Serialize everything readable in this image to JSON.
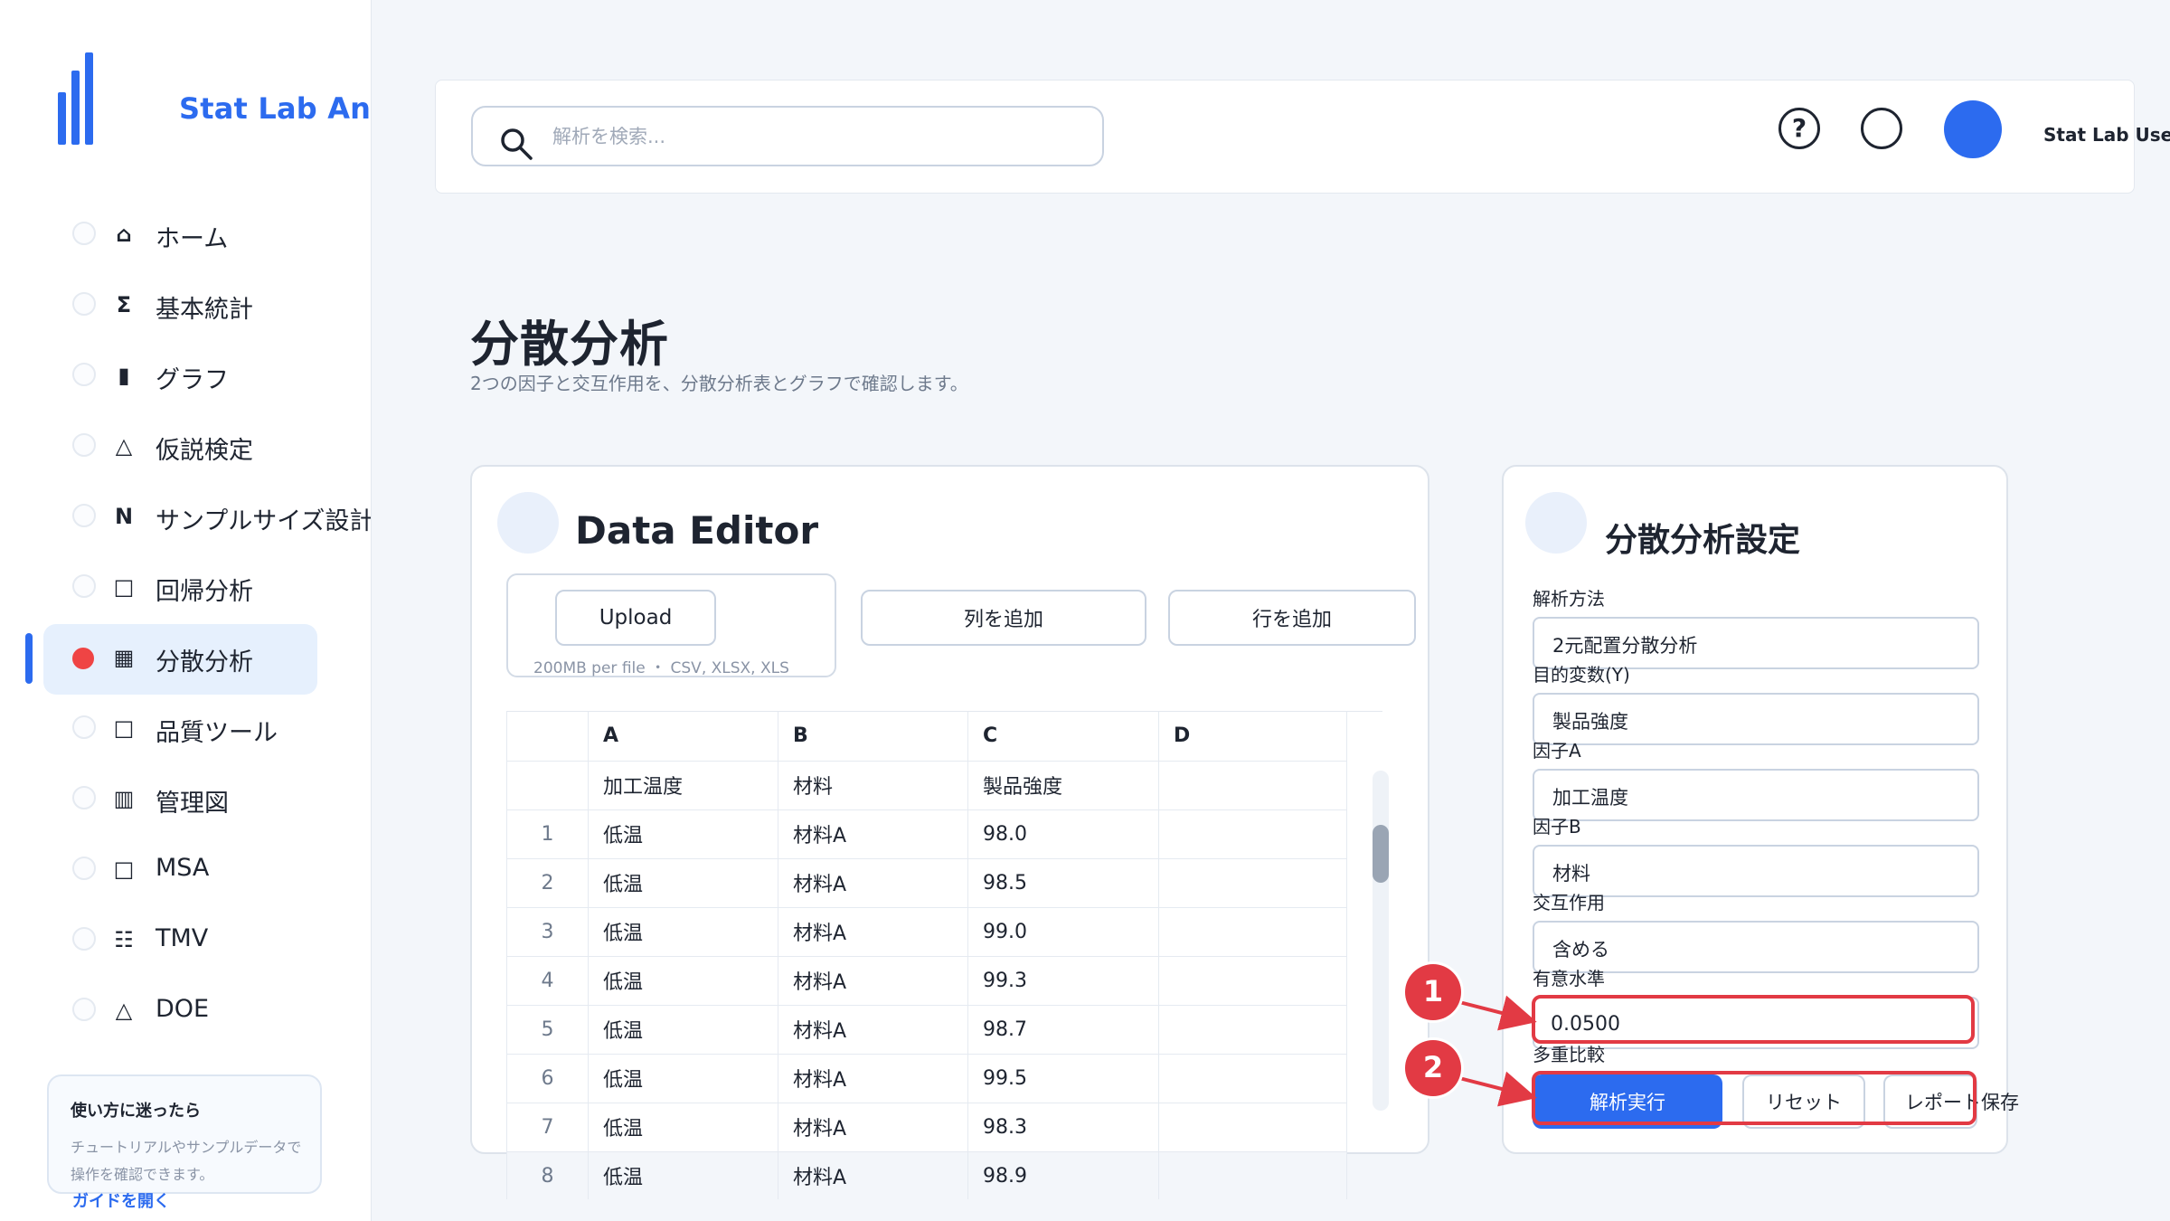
{
  "app": {
    "name": "Stat Lab Analytics"
  },
  "sidebar": {
    "items": [
      {
        "icon": "home-icon",
        "glyph": "⌂",
        "label": "ホーム"
      },
      {
        "icon": "sigma-icon",
        "glyph": "Σ",
        "label": "基本統計"
      },
      {
        "icon": "bar-chart-icon",
        "glyph": "▮",
        "label": "グラフ"
      },
      {
        "icon": "triangle-icon",
        "glyph": "△",
        "label": "仮説検定"
      },
      {
        "icon": "n-letter-icon",
        "glyph": "N",
        "label": "サンプルサイズ設計"
      },
      {
        "icon": "square-icon",
        "glyph": "□",
        "label": "回帰分析"
      },
      {
        "icon": "grid-icon",
        "glyph": "▦",
        "label": "分散分析",
        "active": true
      },
      {
        "icon": "square-icon",
        "glyph": "□",
        "label": "品質ツール"
      },
      {
        "icon": "bars-icon",
        "glyph": "▥",
        "label": "管理図"
      },
      {
        "icon": "square-icon",
        "glyph": "□",
        "label": "MSA"
      },
      {
        "icon": "list-icon",
        "glyph": "☷",
        "label": "TMV"
      },
      {
        "icon": "triangle-icon",
        "glyph": "△",
        "label": "DOE"
      }
    ],
    "help": {
      "title": "使い方に迷ったら",
      "body": "チュートリアルやサンプルデータで操作を確認できます。",
      "link": "ガイドを開く"
    }
  },
  "header": {
    "search_placeholder": "解析を検索...",
    "help_glyph": "?",
    "user_name": "Stat Lab User"
  },
  "page": {
    "title": "分散分析",
    "subtitle": "2つの因子と交互作用を、分散分析表とグラフで確認します。"
  },
  "editor": {
    "title": "Data Editor",
    "upload_label": "Upload",
    "upload_hint": "200MB per file ・ CSV, XLSX, XLS",
    "add_column": "列を追加",
    "add_row": "行を追加",
    "columns": [
      "",
      "A",
      "B",
      "C",
      "D"
    ],
    "header_row": [
      "",
      "加工温度",
      "材料",
      "製品強度",
      ""
    ],
    "rows": [
      [
        "1",
        "低温",
        "材料A",
        "98.0",
        ""
      ],
      [
        "2",
        "低温",
        "材料A",
        "98.5",
        ""
      ],
      [
        "3",
        "低温",
        "材料A",
        "99.0",
        ""
      ],
      [
        "4",
        "低温",
        "材料A",
        "99.3",
        ""
      ],
      [
        "5",
        "低温",
        "材料A",
        "98.7",
        ""
      ],
      [
        "6",
        "低温",
        "材料A",
        "99.5",
        ""
      ],
      [
        "7",
        "低温",
        "材料A",
        "98.3",
        ""
      ],
      [
        "8",
        "低温",
        "材料A",
        "98.9",
        ""
      ]
    ]
  },
  "settings": {
    "title": "分散分析設定",
    "method_label": "解析方法",
    "method_value": "2元配置分散分析",
    "target_label": "目的変数(Y)",
    "target_value": "製品強度",
    "factor_a_label": "因子A",
    "factor_a_value": "加工温度",
    "factor_b_label": "因子B",
    "factor_b_value": "材料",
    "interaction_label": "交互作用",
    "interaction_value": "含める",
    "alpha_label": "有意水準",
    "alpha_value": "0.0500",
    "multi_label": "多重比較",
    "run_label": "解析実行",
    "reset_label": "リセット",
    "save_label": "レポート保存"
  },
  "annotations": {
    "marker1": "1",
    "marker2": "2",
    "color": "#E23A44"
  },
  "colors": {
    "accent": "#2C6BEF",
    "active_nav_bg": "#E6F0FD",
    "active_dot": "#EF4444"
  }
}
